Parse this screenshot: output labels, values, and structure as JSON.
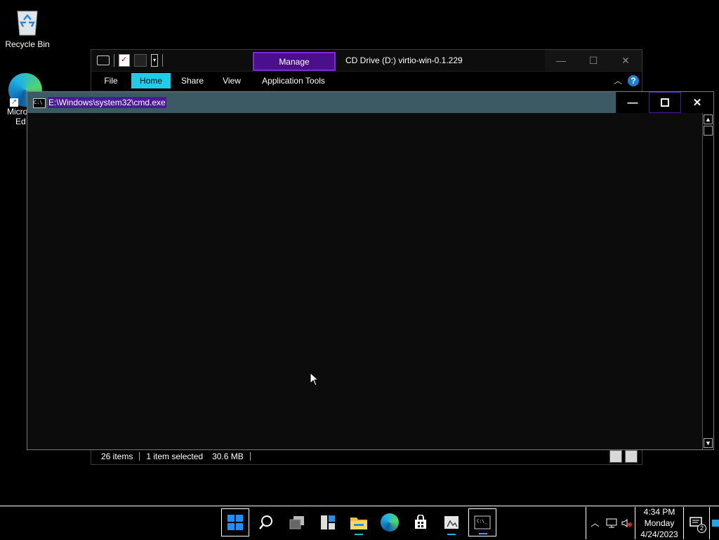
{
  "desktop": {
    "recycle_bin": "Recycle Bin",
    "edge_label_line1": "Micro",
    "edge_label_line2": "Ed"
  },
  "explorer": {
    "manage_tab": "Manage",
    "title": "CD Drive (D:) virtio-win-0.1.229",
    "ribbon_tabs": [
      "File",
      "Home",
      "Share",
      "View",
      "Application Tools"
    ],
    "help": "?",
    "status_items": "26 items",
    "status_selected": "1 item selected",
    "status_size": "30.6 MB"
  },
  "cmd": {
    "title": "E:\\Windows\\system32\\cmd.exe",
    "icon_text": "C:\\"
  },
  "taskbar": {
    "apps": [
      "start-icon",
      "search-icon",
      "task-view-icon",
      "widgets-icon",
      "file-explorer-icon",
      "edge-icon",
      "store-icon",
      "setup-app-icon",
      "terminal-icon"
    ],
    "time": "4:34 PM",
    "day": "Monday",
    "date": "4/24/2023",
    "notifications_count": "2"
  },
  "colors": {
    "accent_cyan": "#20cde8",
    "manage_purple": "#4a0f8a",
    "cmd_title_bg": "#3b5a63",
    "selection_purple": "#4a1a9a"
  }
}
